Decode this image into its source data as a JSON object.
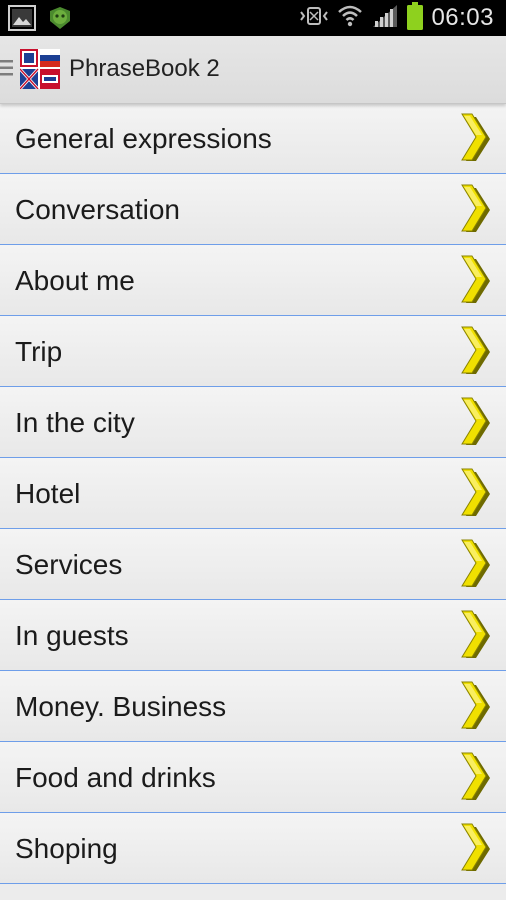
{
  "status_bar": {
    "time": "06:03",
    "left_icons": [
      "gallery-icon",
      "android-app-icon"
    ],
    "right_icons": [
      "vibrate-icon",
      "wifi-icon",
      "signal-icon",
      "battery-icon"
    ],
    "battery_color": "#8ed11e"
  },
  "action_bar": {
    "title": "PhraseBook 2",
    "logo_icon": "flags-logo-icon",
    "menu_icon": "menu-icon"
  },
  "list": {
    "chevron_color": "#f0e000",
    "divider_color": "#6e9ee9",
    "items": [
      {
        "label": "General expressions"
      },
      {
        "label": "Conversation"
      },
      {
        "label": "About me"
      },
      {
        "label": "Trip"
      },
      {
        "label": "In the city"
      },
      {
        "label": "Hotel"
      },
      {
        "label": "Services"
      },
      {
        "label": "In guests"
      },
      {
        "label": "Money. Business"
      },
      {
        "label": "Food and drinks"
      },
      {
        "label": "Shoping"
      }
    ]
  }
}
